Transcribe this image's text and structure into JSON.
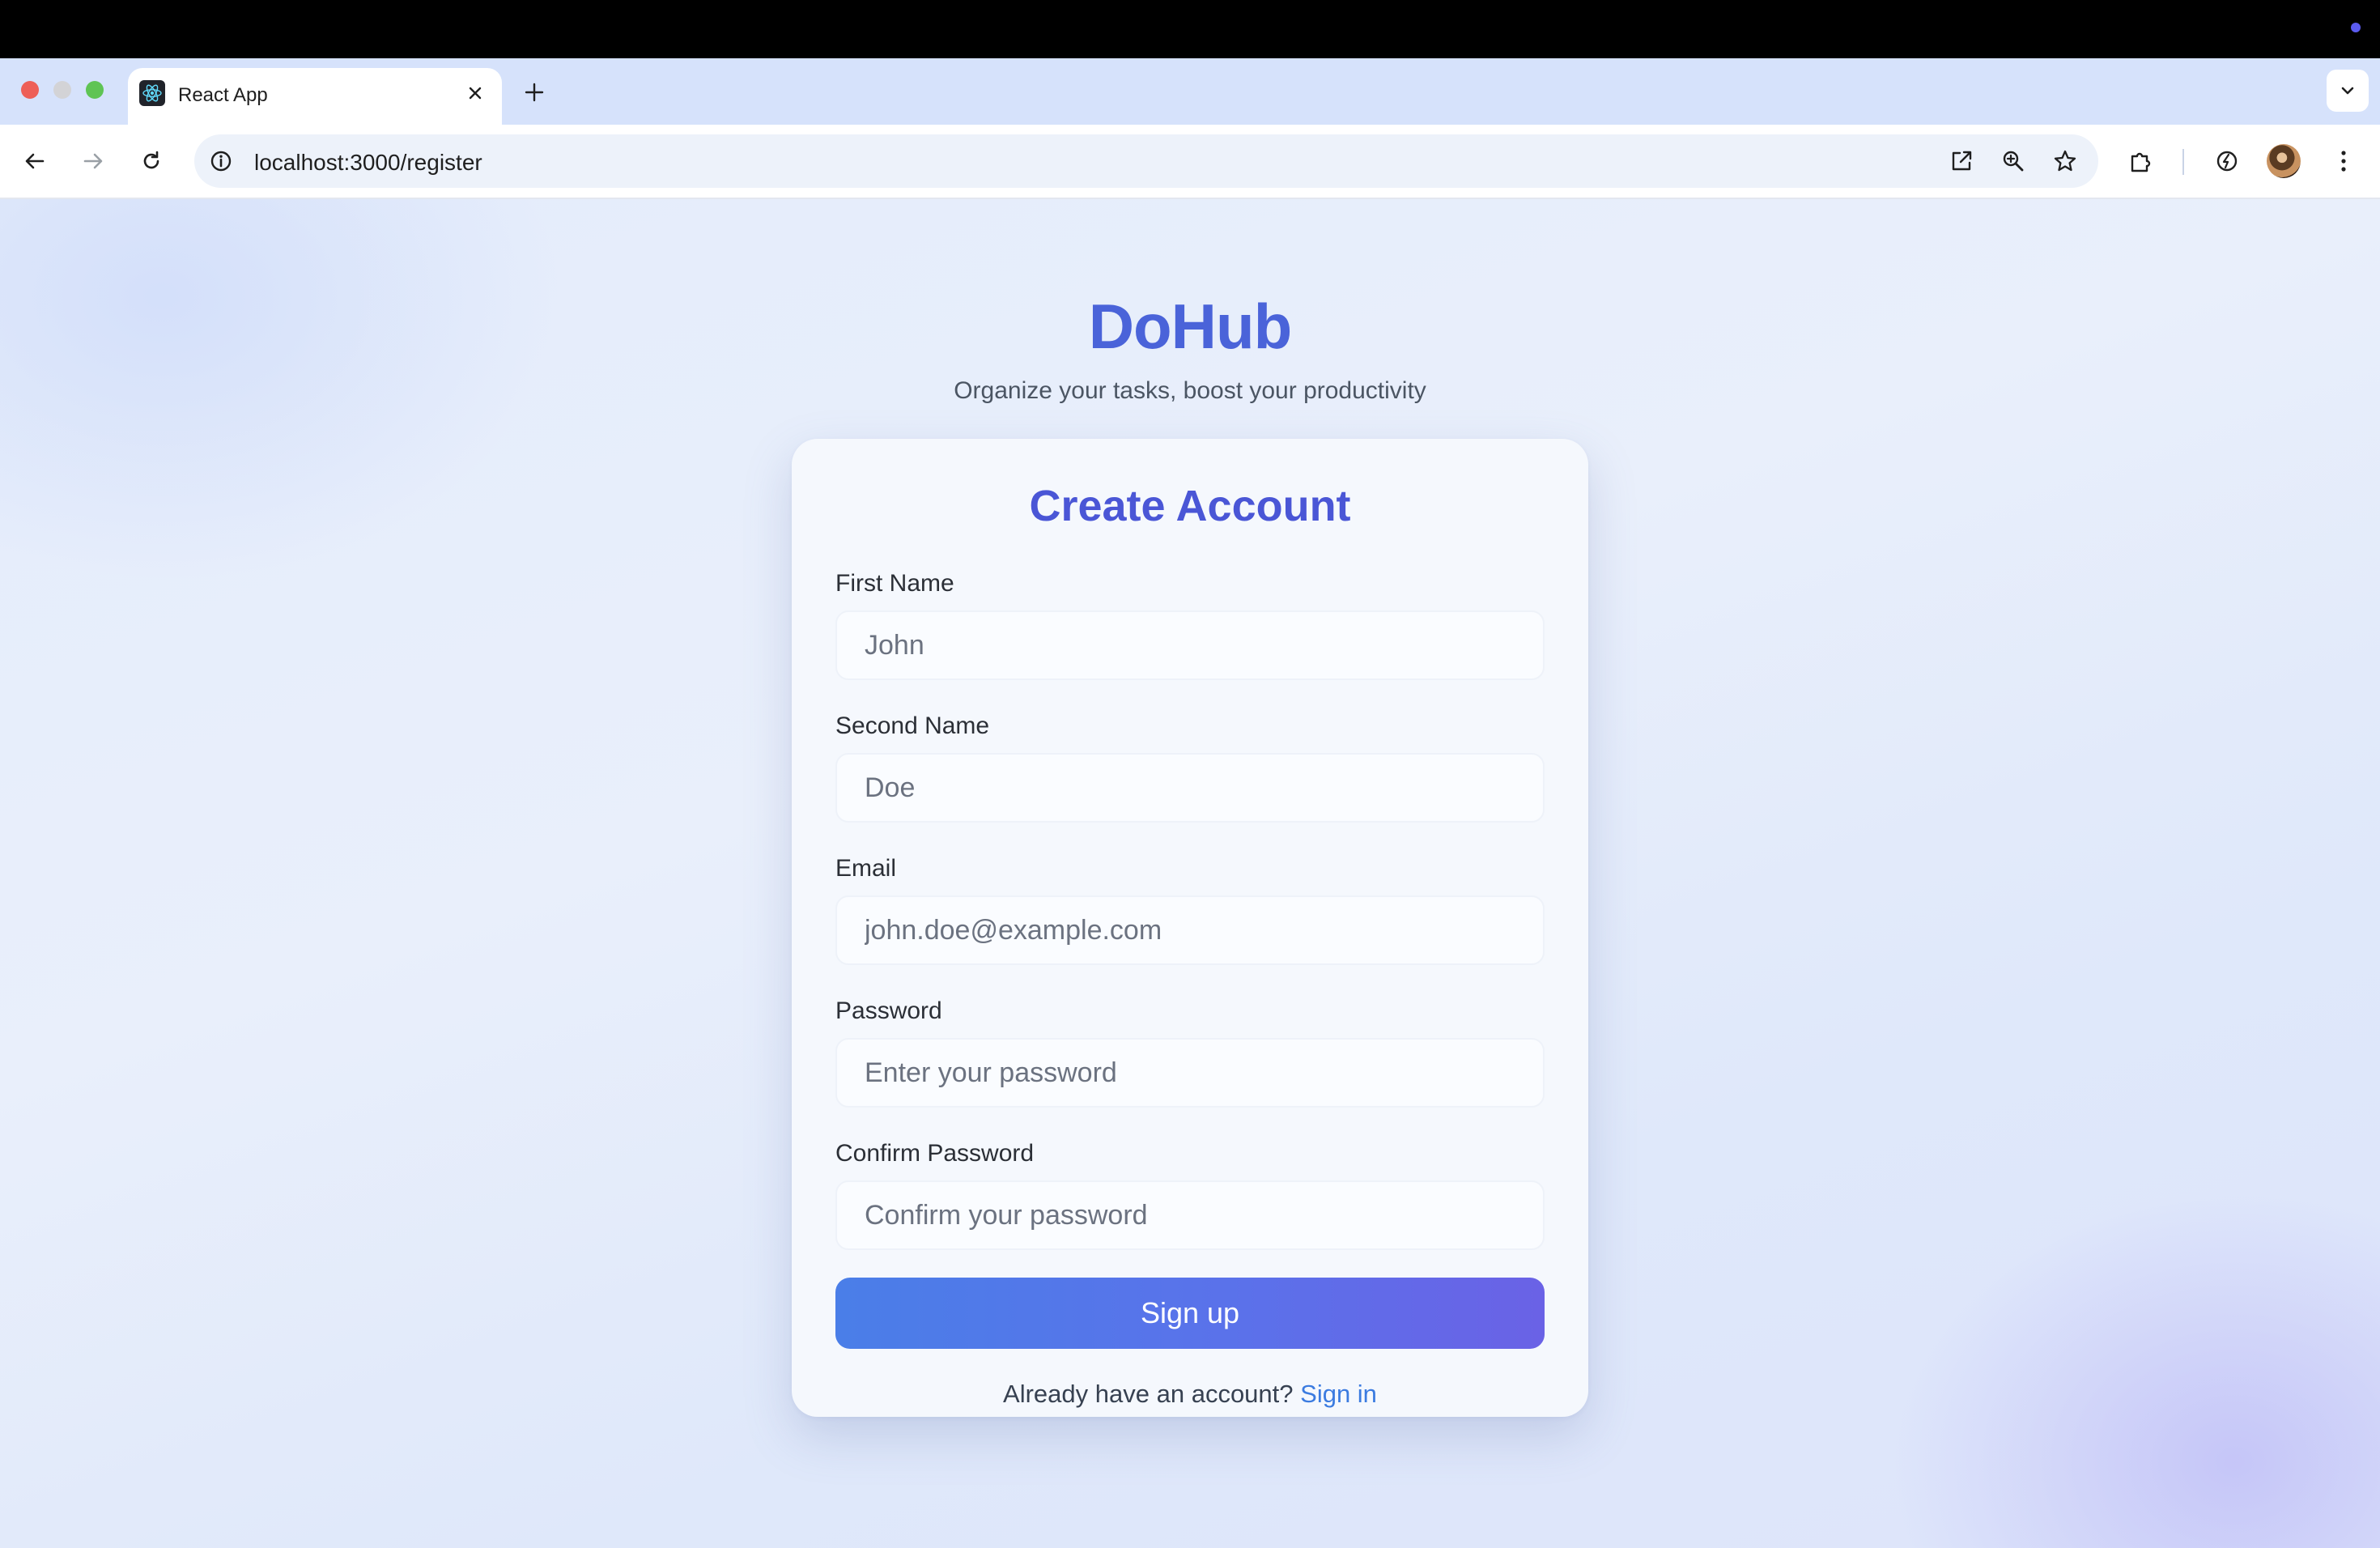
{
  "browser": {
    "tab_title": "React App",
    "url": "localhost:3000/register"
  },
  "app": {
    "brand": "DoHub",
    "tagline": "Organize your tasks, boost your productivity"
  },
  "form": {
    "title": "Create Account",
    "fields": [
      {
        "label": "First Name",
        "placeholder": "John"
      },
      {
        "label": "Second Name",
        "placeholder": "Doe"
      },
      {
        "label": "Email",
        "placeholder": "john.doe@example.com"
      },
      {
        "label": "Password",
        "placeholder": "Enter your password"
      },
      {
        "label": "Confirm Password",
        "placeholder": "Confirm your password"
      }
    ],
    "submit_label": "Sign up",
    "footer_text": "Already have an account?",
    "footer_link": "Sign in"
  },
  "colors": {
    "brand": "#4a63d9",
    "title": "#4a56d6",
    "link": "#3b7be0",
    "button_gradient_start": "#4a7ee8",
    "button_gradient_end": "#6a62e6"
  }
}
